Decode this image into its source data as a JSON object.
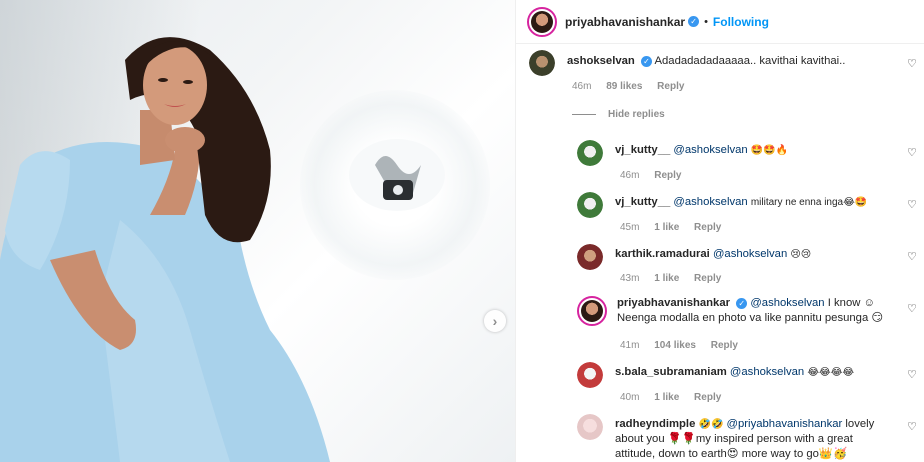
{
  "post": {
    "author": "priyabhavanishankar",
    "follow_status": "Following",
    "separator": "•"
  },
  "comments": [
    {
      "user": "ashokselvan",
      "verified": true,
      "text": "Adadadadadaaaaa.. kavithai kavithai..",
      "time": "46m",
      "likes": "89 likes",
      "reply": "Reply",
      "avatar_color": "#3b3f2a"
    }
  ],
  "hide_replies": "Hide replies",
  "replies": [
    {
      "user": "vj_kutty__",
      "mention": "@ashokselvan",
      "text": "🤩🤩🔥",
      "time": "46m",
      "likes": "",
      "reply": "Reply",
      "avatar_color": "#3f7a3a"
    },
    {
      "user": "vj_kutty__",
      "mention": "@ashokselvan",
      "text": "military ne enna inga😂🤩",
      "time": "45m",
      "likes": "1 like",
      "reply": "Reply",
      "avatar_color": "#3f7a3a"
    },
    {
      "user": "karthik.ramadurai",
      "mention": "@ashokselvan",
      "text": "😢😢",
      "time": "43m",
      "likes": "1 like",
      "reply": "Reply",
      "avatar_color": "#7a2a2a"
    },
    {
      "user": "priyabhavanishankar",
      "verified": true,
      "mention": "@ashokselvan",
      "text_line1": "I know ☺",
      "text_line2": "Neenga modalla en photo va like pannitu pesunga 😏",
      "time": "41m",
      "likes": "104 likes",
      "reply": "Reply",
      "avatar_color": "#9fb7c6"
    },
    {
      "user": "s.bala_subramaniam",
      "mention": "@ashokselvan",
      "text": "😂😂😂😂",
      "time": "40m",
      "likes": "1 like",
      "reply": "Reply",
      "avatar_color": "#c33b3b"
    },
    {
      "user": "radheyndimple",
      "pre": "🤣🤣",
      "mention": "@priyabhavanishankar",
      "text_line1": "lovely",
      "text_line2": "about you 🌹🌹my inspired person with a great",
      "text_line3": "attitude, down to earth😍 more way to go👑🥳",
      "avatar_color": "#e6c7c7"
    }
  ],
  "icons": {
    "heart": "heart-icon",
    "verified": "verified-badge-icon",
    "next": "chevron-right-icon"
  }
}
